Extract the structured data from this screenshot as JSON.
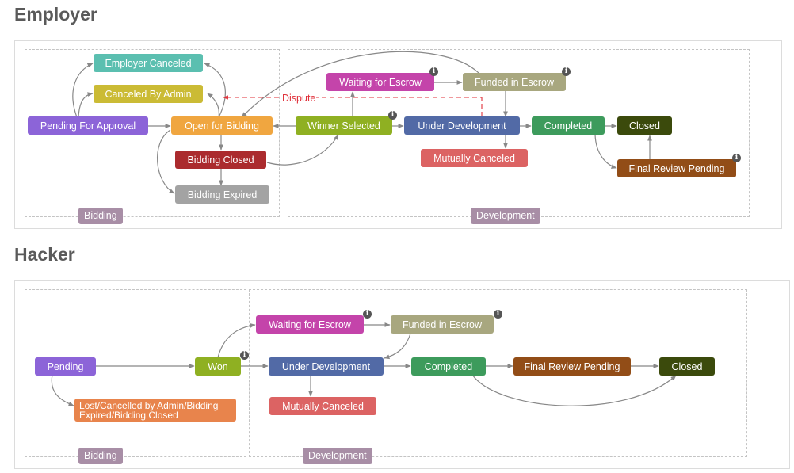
{
  "employer": {
    "title": "Employer",
    "groups": {
      "bidding": "Bidding",
      "development": "Development"
    },
    "nodes": {
      "employer_canceled": {
        "label": "Employer Canceled",
        "color": "#5bbfb0"
      },
      "canceled_by_admin": {
        "label": "Canceled By Admin",
        "color": "#cbbb35"
      },
      "pending_for_approval": {
        "label": "Pending For Approval",
        "color": "#8c64d8"
      },
      "open_for_bidding": {
        "label": "Open for Bidding",
        "color": "#f0a640"
      },
      "bidding_closed": {
        "label": "Bidding Closed",
        "color": "#ab2b2e"
      },
      "bidding_expired": {
        "label": "Bidding Expired",
        "color": "#a3a3a3"
      },
      "winner_selected": {
        "label": "Winner Selected",
        "color": "#8fb022",
        "info": true
      },
      "waiting_for_escrow": {
        "label": "Waiting for Escrow",
        "color": "#c444aa",
        "info": true
      },
      "funded_in_escrow": {
        "label": "Funded in Escrow",
        "color": "#a8a77f",
        "info": true
      },
      "under_development": {
        "label": "Under Development",
        "color": "#526aa6"
      },
      "mutually_canceled": {
        "label": "Mutually Canceled",
        "color": "#dc6363"
      },
      "completed": {
        "label": "Completed",
        "color": "#3d9b5c"
      },
      "closed": {
        "label": "Closed",
        "color": "#3b4a0c"
      },
      "final_review_pending": {
        "label": "Final Review Pending",
        "color": "#924d17",
        "info": true
      }
    },
    "dispute_label": "Dispute"
  },
  "hacker": {
    "title": "Hacker",
    "groups": {
      "bidding": "Bidding",
      "development": "Development"
    },
    "nodes": {
      "pending": {
        "label": "Pending",
        "color": "#8c64d8"
      },
      "lost": {
        "label": "Lost/Cancelled by Admin/Bidding Expired/Bidding Closed",
        "color": "#e8844c"
      },
      "won": {
        "label": "Won",
        "color": "#8fb022",
        "info": true
      },
      "waiting_for_escrow": {
        "label": "Waiting for Escrow",
        "color": "#c444aa",
        "info": true
      },
      "funded_in_escrow": {
        "label": "Funded in Escrow",
        "color": "#a8a77f",
        "info": true
      },
      "under_development": {
        "label": "Under Development",
        "color": "#526aa6"
      },
      "mutually_canceled": {
        "label": "Mutually Canceled",
        "color": "#dc6363"
      },
      "completed": {
        "label": "Completed",
        "color": "#3d9b5c"
      },
      "final_review_pending": {
        "label": "Final Review Pending",
        "color": "#924d17"
      },
      "closed": {
        "label": "Closed",
        "color": "#3b4a0c"
      }
    }
  },
  "info_icon_glyph": "i"
}
